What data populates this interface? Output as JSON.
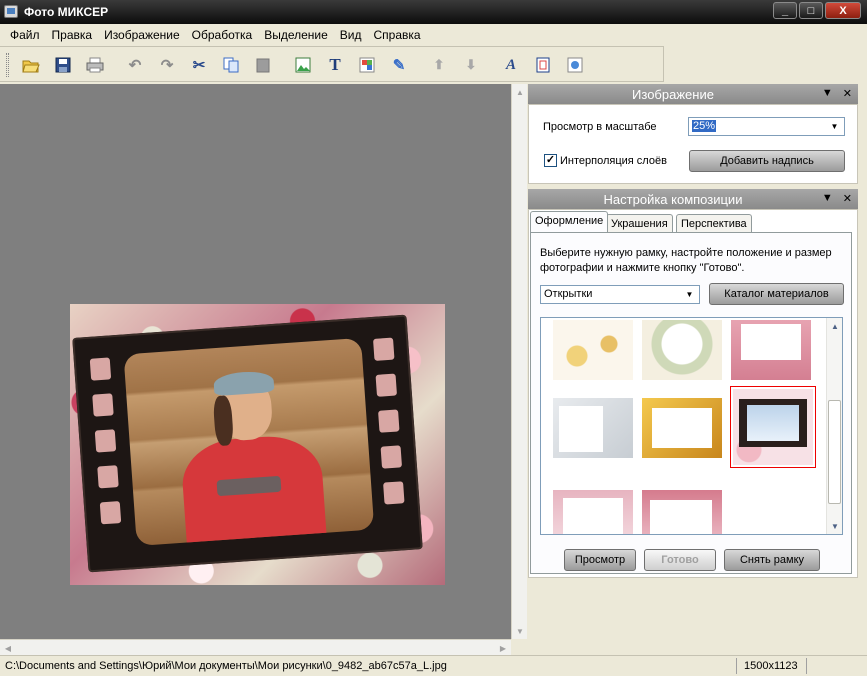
{
  "window": {
    "title": "Фото МИКСЕР",
    "minimize": "_",
    "maximize": "□",
    "close": "X"
  },
  "menu": [
    "Файл",
    "Правка",
    "Изображение",
    "Обработка",
    "Выделение",
    "Вид",
    "Справка"
  ],
  "toolbar_icons": [
    "open-icon",
    "save-icon",
    "print-icon",
    "undo-icon",
    "redo-icon",
    "cut-icon",
    "copy-icon",
    "paste-icon",
    "insert-image-icon",
    "text-icon",
    "layer-icon",
    "wand-icon",
    "move-up-icon",
    "move-down-icon",
    "font-icon",
    "frame-icon",
    "effects-icon"
  ],
  "image_panel": {
    "title": "Изображение",
    "zoom_label": "Просмотр в масштабе",
    "zoom_value": "25%",
    "interp_label": "Интерполяция слоёв",
    "interp_checked": true,
    "add_caption_button": "Добавить надпись"
  },
  "composition_panel": {
    "title": "Настройка композиции",
    "tabs": [
      "Оформление",
      "Украшения",
      "Перспектива"
    ],
    "active_tab": 0,
    "description": "Выберите нужную рамку, настройте положение и размер фотографии и нажмите кнопку \"Готово\".",
    "category_value": "Открытки",
    "catalog_button": "Каталог материалов",
    "preview_button": "Просмотр",
    "done_button": "Готово",
    "remove_frame_button": "Снять рамку"
  },
  "status": {
    "path": "C:\\Documents and Settings\\Юрий\\Мои документы\\Мои рисунки\\0_9482_ab67c57a_L.jpg",
    "size": "1500x1123"
  },
  "colors": {
    "canvas": "#7f7f7f",
    "titlebar": "#0c0c0c",
    "panel_header": "#999999",
    "selection": "#316ac5",
    "thumb_selected": "#ee0000"
  }
}
